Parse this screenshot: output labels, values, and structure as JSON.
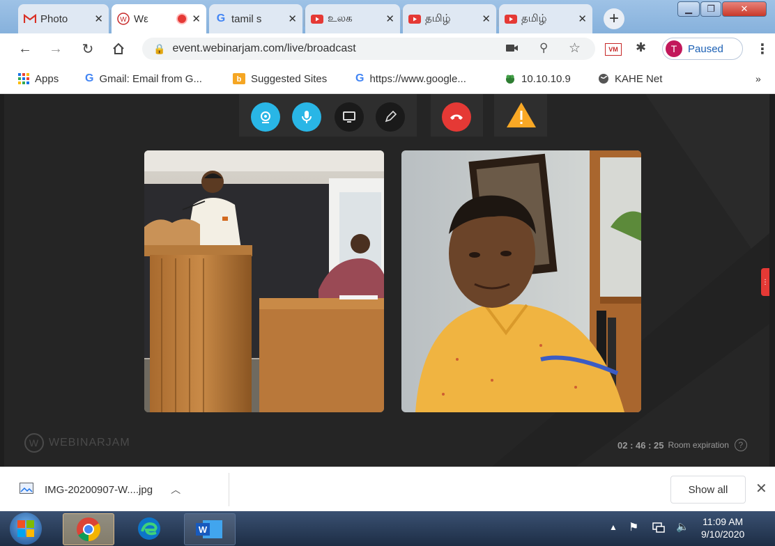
{
  "tabs": [
    {
      "label": "Photo",
      "icon": "gmail-icon"
    },
    {
      "label": "Wε",
      "icon": "webinarjam-icon",
      "recording": true
    },
    {
      "label": "tamil s",
      "icon": "google-icon"
    },
    {
      "label": "உலக",
      "icon": "youtube-icon"
    },
    {
      "label": "தமிழ்",
      "icon": "youtube-icon"
    },
    {
      "label": "தமிழ்",
      "icon": "youtube-icon"
    }
  ],
  "address": {
    "url": "event.webinarjam.com/live/broadcast"
  },
  "profile": {
    "initial": "T",
    "status": "Paused"
  },
  "bookmarks": [
    {
      "label": "Apps",
      "icon": "apps-grid-icon"
    },
    {
      "label": "Gmail: Email from G...",
      "icon": "google-icon"
    },
    {
      "label": "Suggested Sites",
      "icon": "suggested-sites-icon"
    },
    {
      "label": "https://www.google...",
      "icon": "google-icon"
    },
    {
      "label": "10.10.10.9",
      "icon": "frog-icon"
    },
    {
      "label": "KAHE Net",
      "icon": "globe-icon"
    }
  ],
  "bookmarks_more": "»",
  "webinar": {
    "brand": "WEBINARJAM",
    "timer": "02 : 46 : 25",
    "timer_label": "Room expiration",
    "help": "?"
  },
  "download": {
    "filename": "IMG-20200907-W....jpg",
    "show_all": "Show all"
  },
  "clock": {
    "time": "11:09 AM",
    "date": "9/10/2020"
  },
  "colors": {
    "accent_cyan": "#29b6e6",
    "hangup_red": "#e53935",
    "warning_yellow": "#f9a825"
  }
}
